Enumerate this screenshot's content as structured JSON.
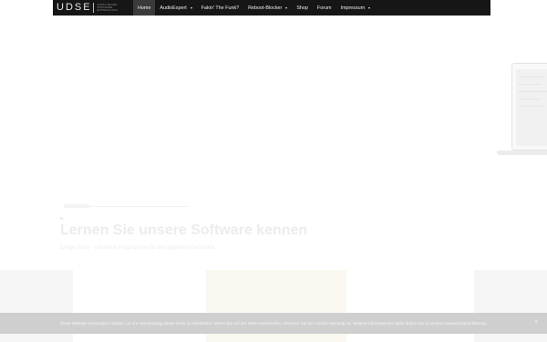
{
  "navbar": {
    "logo": {
      "text": "UDSE",
      "sub_lines": [
        "SANTA SEINER",
        "SOFTWARE",
        "ENTWICKLUNG"
      ]
    },
    "items": [
      {
        "label": "Home",
        "active": true,
        "has_dropdown": false
      },
      {
        "label": "AudioExpert",
        "active": false,
        "has_dropdown": true
      },
      {
        "label": "Fakin' The Funk?",
        "active": false,
        "has_dropdown": false
      },
      {
        "label": "Reboot-Blocker",
        "active": false,
        "has_dropdown": true
      },
      {
        "label": "Shop",
        "active": false,
        "has_dropdown": false
      },
      {
        "label": "Forum",
        "active": false,
        "has_dropdown": false
      },
      {
        "label": "Impressum",
        "active": false,
        "has_dropdown": true
      }
    ],
    "colors": {
      "bar": "#161616",
      "active": "#3a3a3a",
      "text": "#f0f0f0"
    }
  },
  "hero": {
    "title": "Lernen Sie unsere Software kennen",
    "subtitle": "Einige Tools · Nützliche Programme für den täglichen Gebrauch"
  },
  "cookie_bar": {
    "text": "Diese Website verwendet Cookies, um Ihr Verwendung dieser Seite zu erleichtern. Wenn Sie auf der Seite weitersurfen, stimmen Sie der Cookie-Nutzung zu. Weitere Informationen dazu finden Sie in unserer Datenschutzerklärung.",
    "close_icon": "close-icon",
    "close_glyph": "×"
  }
}
